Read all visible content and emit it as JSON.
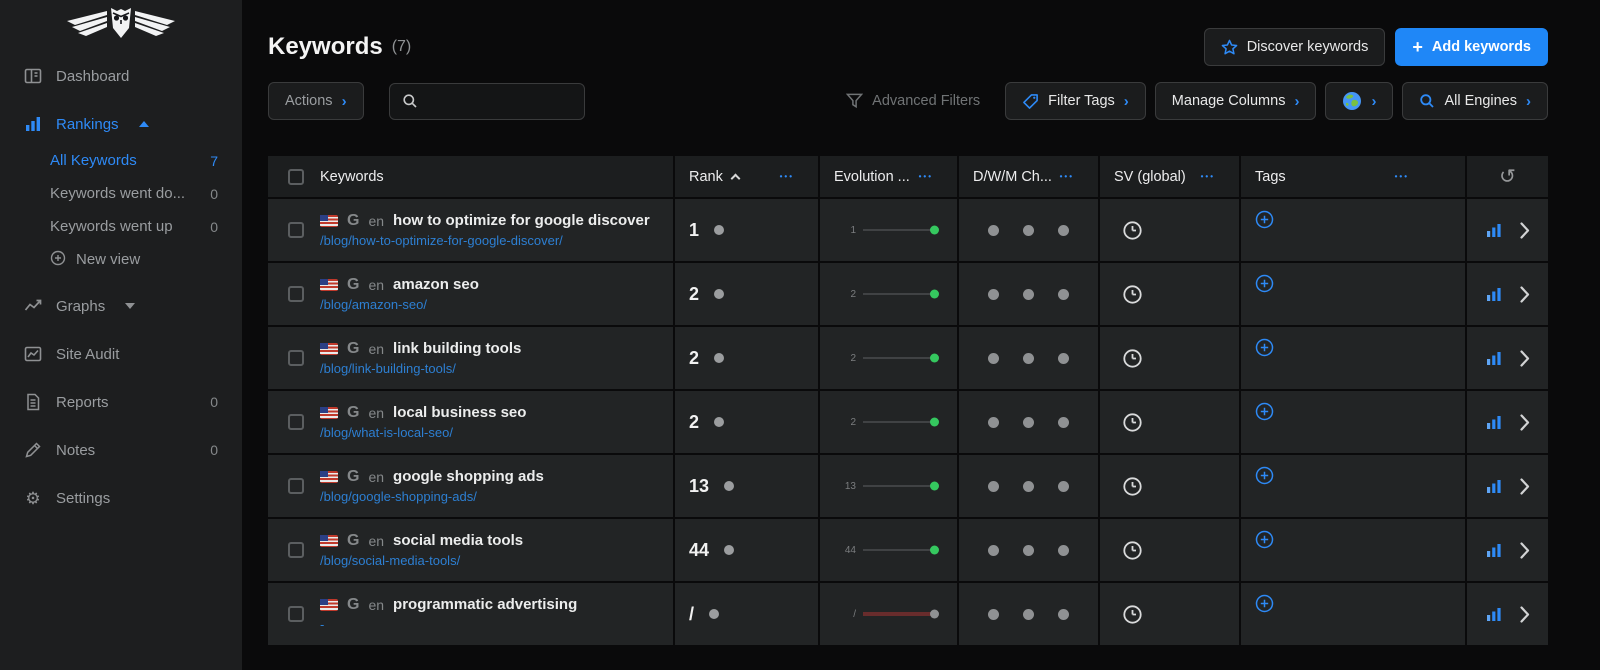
{
  "colors": {
    "accent_blue": "#2e8af6",
    "primary_button": "#1f87f7",
    "green_dot": "#35c85f",
    "down_red": "#682c2c",
    "url_blue": "#2d7fd2"
  },
  "sidebar": {
    "nav": [
      {
        "id": "dashboard",
        "label": "Dashboard"
      },
      {
        "id": "rankings",
        "label": "Rankings",
        "active": true,
        "expanded": true
      },
      {
        "id": "graphs",
        "label": "Graphs"
      },
      {
        "id": "site-audit",
        "label": "Site Audit"
      },
      {
        "id": "reports",
        "label": "Reports",
        "count": "0"
      },
      {
        "id": "notes",
        "label": "Notes",
        "count": "0"
      },
      {
        "id": "settings",
        "label": "Settings"
      }
    ],
    "rankings_children": [
      {
        "id": "all-keywords",
        "label": "All Keywords",
        "count": "7",
        "active": true
      },
      {
        "id": "keywords-went-down",
        "label": "Keywords went do...",
        "count": "0"
      },
      {
        "id": "keywords-went-up",
        "label": "Keywords went up",
        "count": "0"
      },
      {
        "id": "new-view",
        "label": "New view"
      }
    ]
  },
  "page": {
    "title": "Keywords",
    "count": "(7)"
  },
  "header_actions": {
    "discover_label": "Discover keywords",
    "add_plus": "+",
    "add_label": "Add keywords"
  },
  "toolbar": {
    "actions_label": "Actions",
    "search_placeholder": "",
    "search_value": "",
    "advanced_filters_label": "Advanced Filters",
    "filter_tags_label": "Filter Tags",
    "manage_columns_label": "Manage Columns",
    "all_engines_label": "All Engines"
  },
  "icons": {
    "ellipsis": "•••",
    "undo": "↺"
  },
  "table": {
    "columns": {
      "keywords": "Keywords",
      "rank": "Rank",
      "evolution": "Evolution ...",
      "dwm": "D/W/M Ch...",
      "sv": "SV (global)",
      "tags": "Tags"
    },
    "rows": [
      {
        "flag": "us",
        "engine": "G",
        "lang": "en",
        "keyword": "how to optimize for google discover",
        "url": "/blog/how-to-optimize-for-google-discover/",
        "rank": "1",
        "trend": "up"
      },
      {
        "flag": "us",
        "engine": "G",
        "lang": "en",
        "keyword": "amazon seo",
        "url": "/blog/amazon-seo/",
        "rank": "2",
        "trend": "up"
      },
      {
        "flag": "us",
        "engine": "G",
        "lang": "en",
        "keyword": "link building tools",
        "url": "/blog/link-building-tools/",
        "rank": "2",
        "trend": "up"
      },
      {
        "flag": "us",
        "engine": "G",
        "lang": "en",
        "keyword": "local business seo",
        "url": "/blog/what-is-local-seo/",
        "rank": "2",
        "trend": "up"
      },
      {
        "flag": "us",
        "engine": "G",
        "lang": "en",
        "keyword": "google shopping ads",
        "url": "/blog/google-shopping-ads/",
        "rank": "13",
        "trend": "up"
      },
      {
        "flag": "us",
        "engine": "G",
        "lang": "en",
        "keyword": "social media tools",
        "url": "/blog/social-media-tools/",
        "rank": "44",
        "trend": "up"
      },
      {
        "flag": "us",
        "engine": "G",
        "lang": "en",
        "keyword": "programmatic advertising",
        "url": "-",
        "rank": "/",
        "trend": "down"
      }
    ]
  }
}
